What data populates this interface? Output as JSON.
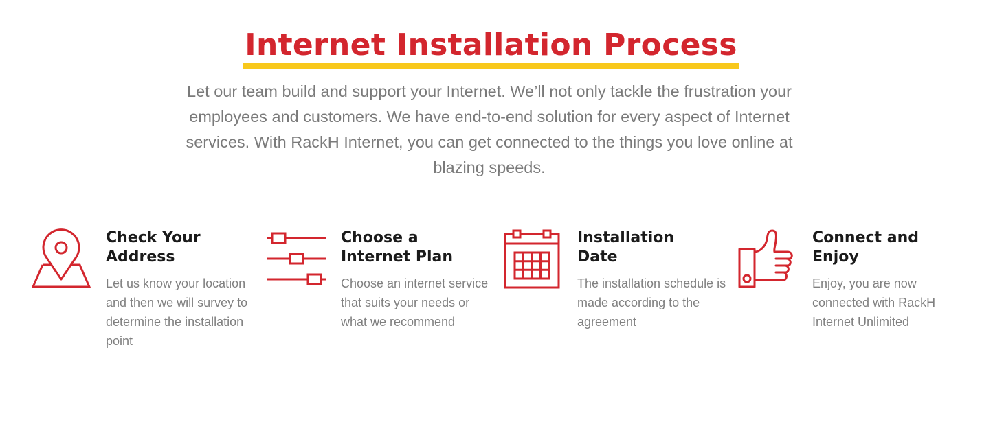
{
  "header": {
    "title": "Internet Installation Process",
    "intro": "Let our team build and support your Internet. We’ll not only tackle the frustration your employees and customers. We have end-to-end solution for every aspect of Internet services. With RackH Internet, you can get connected to the things you love online at blazing speeds."
  },
  "colors": {
    "accent": "#d3262e",
    "underline": "#f8c81c",
    "heading": "#1a1a1a",
    "body_text": "#808080"
  },
  "steps": [
    {
      "icon": "map-pin-icon",
      "title_line1": "Check Your",
      "title_line2": "Address",
      "description": "Let us know your location and then we will survey to determine the installation point"
    },
    {
      "icon": "sliders-icon",
      "title_line1": "Choose a",
      "title_line2": "Internet Plan",
      "description": "Choose an internet service that suits your needs or what we recommend"
    },
    {
      "icon": "calendar-icon",
      "title_line1": "Installation",
      "title_line2": "Date",
      "description": "The installation schedule is made according to the agreement"
    },
    {
      "icon": "thumbs-up-icon",
      "title_line1": "Connect and",
      "title_line2": "Enjoy",
      "description": "Enjoy, you are now connected with RackH Internet Unlimited"
    }
  ]
}
